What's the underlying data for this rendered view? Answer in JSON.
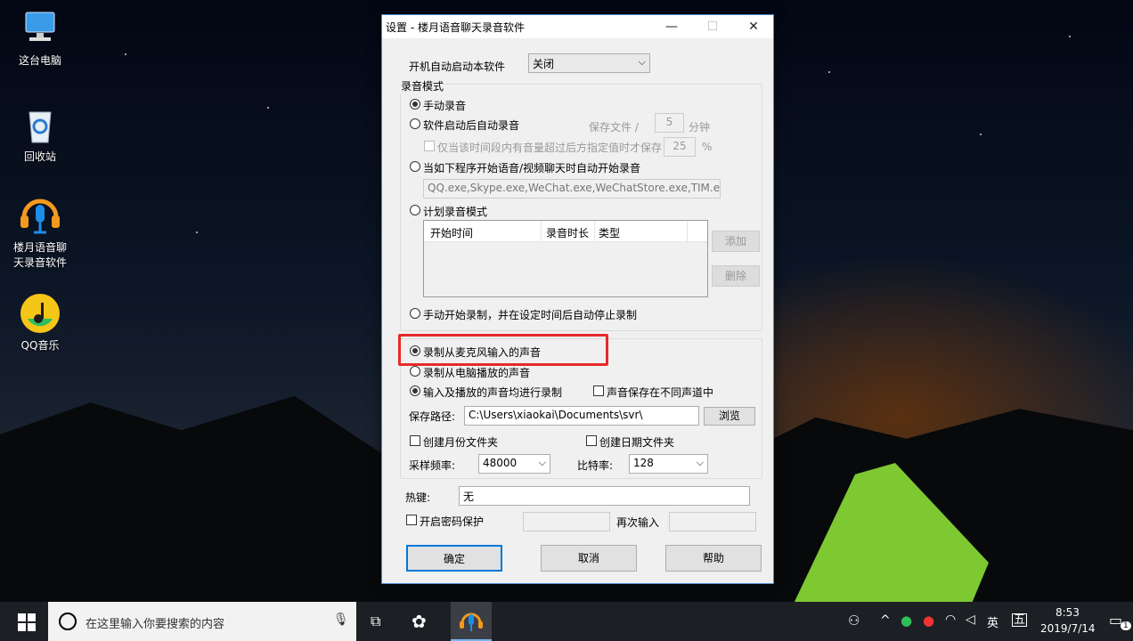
{
  "desktop": {
    "icons": [
      {
        "label": "这台电脑"
      },
      {
        "label": "回收站"
      },
      {
        "label": "楼月语音聊天录音软件"
      },
      {
        "label": "QQ音乐"
      }
    ]
  },
  "dialog": {
    "title": "设置 - 楼月语音聊天录音软件",
    "autostart": {
      "label": "开机自动启动本软件",
      "value": "关闭"
    },
    "record_mode": {
      "group_label": "录音模式",
      "manual": "手动录音",
      "auto_on_start": "软件启动后自动录音",
      "save_file_label": "保存文件 /",
      "save_minutes": "5",
      "minutes_unit": "分钟",
      "volume_check": "仅当该时间段内有音量超过后方指定值时才保存",
      "volume_value": "25",
      "percent": "%",
      "auto_on_programs": "当如下程序开始语音/视频聊天时自动开始录音",
      "programs": "QQ.exe,Skype.exe,WeChat.exe,WeChatStore.exe,TIM.exe",
      "scheduled": "计划录音模式",
      "table_headers": [
        "开始时间",
        "录音时长",
        "类型"
      ],
      "add": "添加",
      "delete": "删除",
      "manual_timed": "手动开始录制，并在设定时间后自动停止录制"
    },
    "source": {
      "mic": "录制从麦克风输入的声音",
      "pc": "录制从电脑播放的声音",
      "both": "输入及播放的声音均进行录制",
      "diff_channel": "声音保存在不同声道中",
      "path_label": "保存路径:",
      "path_value": "C:\\Users\\xiaokai\\Documents\\svr\\",
      "browse": "浏览",
      "monthly_folder": "创建月份文件夹",
      "daily_folder": "创建日期文件夹",
      "sample_label": "采样频率:",
      "sample_value": "48000",
      "bitrate_label": "比特率:",
      "bitrate_value": "128"
    },
    "hotkey": {
      "label": "热键:",
      "value": "无"
    },
    "password": {
      "label": "开启密码保护",
      "reenter": "再次输入"
    },
    "buttons": {
      "ok": "确定",
      "cancel": "取消",
      "help": "帮助"
    },
    "highlight_color": "#e52a2a"
  },
  "taskbar": {
    "search_placeholder": "在这里输入你要搜索的内容",
    "ime_lang": "英",
    "ime_mode": "五",
    "time": "8:53",
    "date": "2019/7/14",
    "notif_count": "1"
  }
}
